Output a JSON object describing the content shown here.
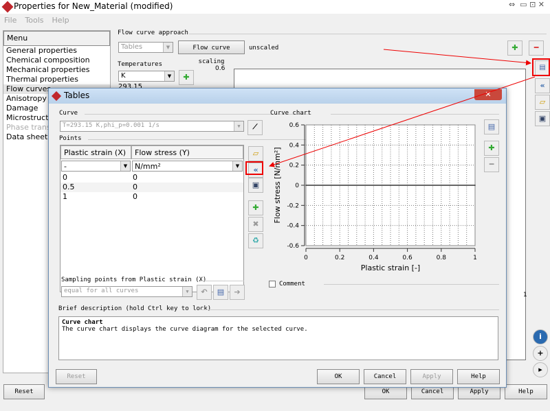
{
  "window": {
    "title": "Properties for New_Material (modified)"
  },
  "menubar": [
    "File",
    "Tools",
    "Help"
  ],
  "sidebar": {
    "header": "Menu",
    "items": [
      {
        "label": "General properties",
        "disabled": false
      },
      {
        "label": "Chemical composition",
        "disabled": false
      },
      {
        "label": "Mechanical properties",
        "disabled": false
      },
      {
        "label": "Thermal properties",
        "disabled": false
      },
      {
        "label": "Flow curves",
        "disabled": false
      },
      {
        "label": "Anisotropy",
        "disabled": false
      },
      {
        "label": "Damage",
        "disabled": false
      },
      {
        "label": "Microstructure",
        "disabled": false
      },
      {
        "label": "Phase transformation",
        "disabled": true
      },
      {
        "label": "Data sheet",
        "disabled": false
      }
    ]
  },
  "main": {
    "approach_label": "Flow curve approach",
    "approach_value": "Tables",
    "scaling_button": "Flow curve scaling",
    "scaling_status": "unscaled",
    "temperatures_label": "Temperatures",
    "temp_unit": "K",
    "temp_value": "293.15",
    "chart_top_tick": "0.6",
    "chart_right_tick": "1",
    "buttons": {
      "reset": "Reset",
      "ok": "OK",
      "cancel": "Cancel",
      "apply": "Apply",
      "help": "Help"
    }
  },
  "dialog": {
    "title": "Tables",
    "curve_label": "Curve",
    "curve_value": "T=293.15 K,phi_p=0.001 1/s",
    "points_label": "Points",
    "columns": [
      "Plastic strain (X)",
      "Flow stress (Y)"
    ],
    "units": [
      "-",
      "N/mm²"
    ],
    "rows": [
      [
        "0",
        "0"
      ],
      [
        "0.5",
        "0"
      ],
      [
        "1",
        "0"
      ]
    ],
    "sampling_label": "Sampling points from Plastic strain (X)",
    "sampling_value": "equal for all curves",
    "chart_section": "Curve chart",
    "comment_label": "Comment",
    "desc_label": "Brief description (hold Ctrl key to lock)",
    "desc_title": "Curve chart",
    "desc_text": "The curve chart displays the curve diagram for the selected curve.",
    "buttons": {
      "reset": "Reset",
      "ok": "OK",
      "cancel": "Cancel",
      "apply": "Apply",
      "help": "Help"
    }
  },
  "chart_data": {
    "type": "line",
    "title": "",
    "xlabel": "Plastic strain [-]",
    "ylabel": "Flow stress [N/mm²]",
    "xlim": [
      0,
      1
    ],
    "ylim": [
      -0.6,
      0.6
    ],
    "xticks": [
      "0",
      "0.2",
      "0.4",
      "0.6",
      "0.8",
      "1"
    ],
    "yticks": [
      "-0.6",
      "-0.4",
      "-0.2",
      "0",
      "0.2",
      "0.4",
      "0.6"
    ],
    "grid": true,
    "series": [
      {
        "name": "curve",
        "x": [
          0,
          0.5,
          1
        ],
        "y": [
          0,
          0,
          0
        ]
      }
    ]
  }
}
